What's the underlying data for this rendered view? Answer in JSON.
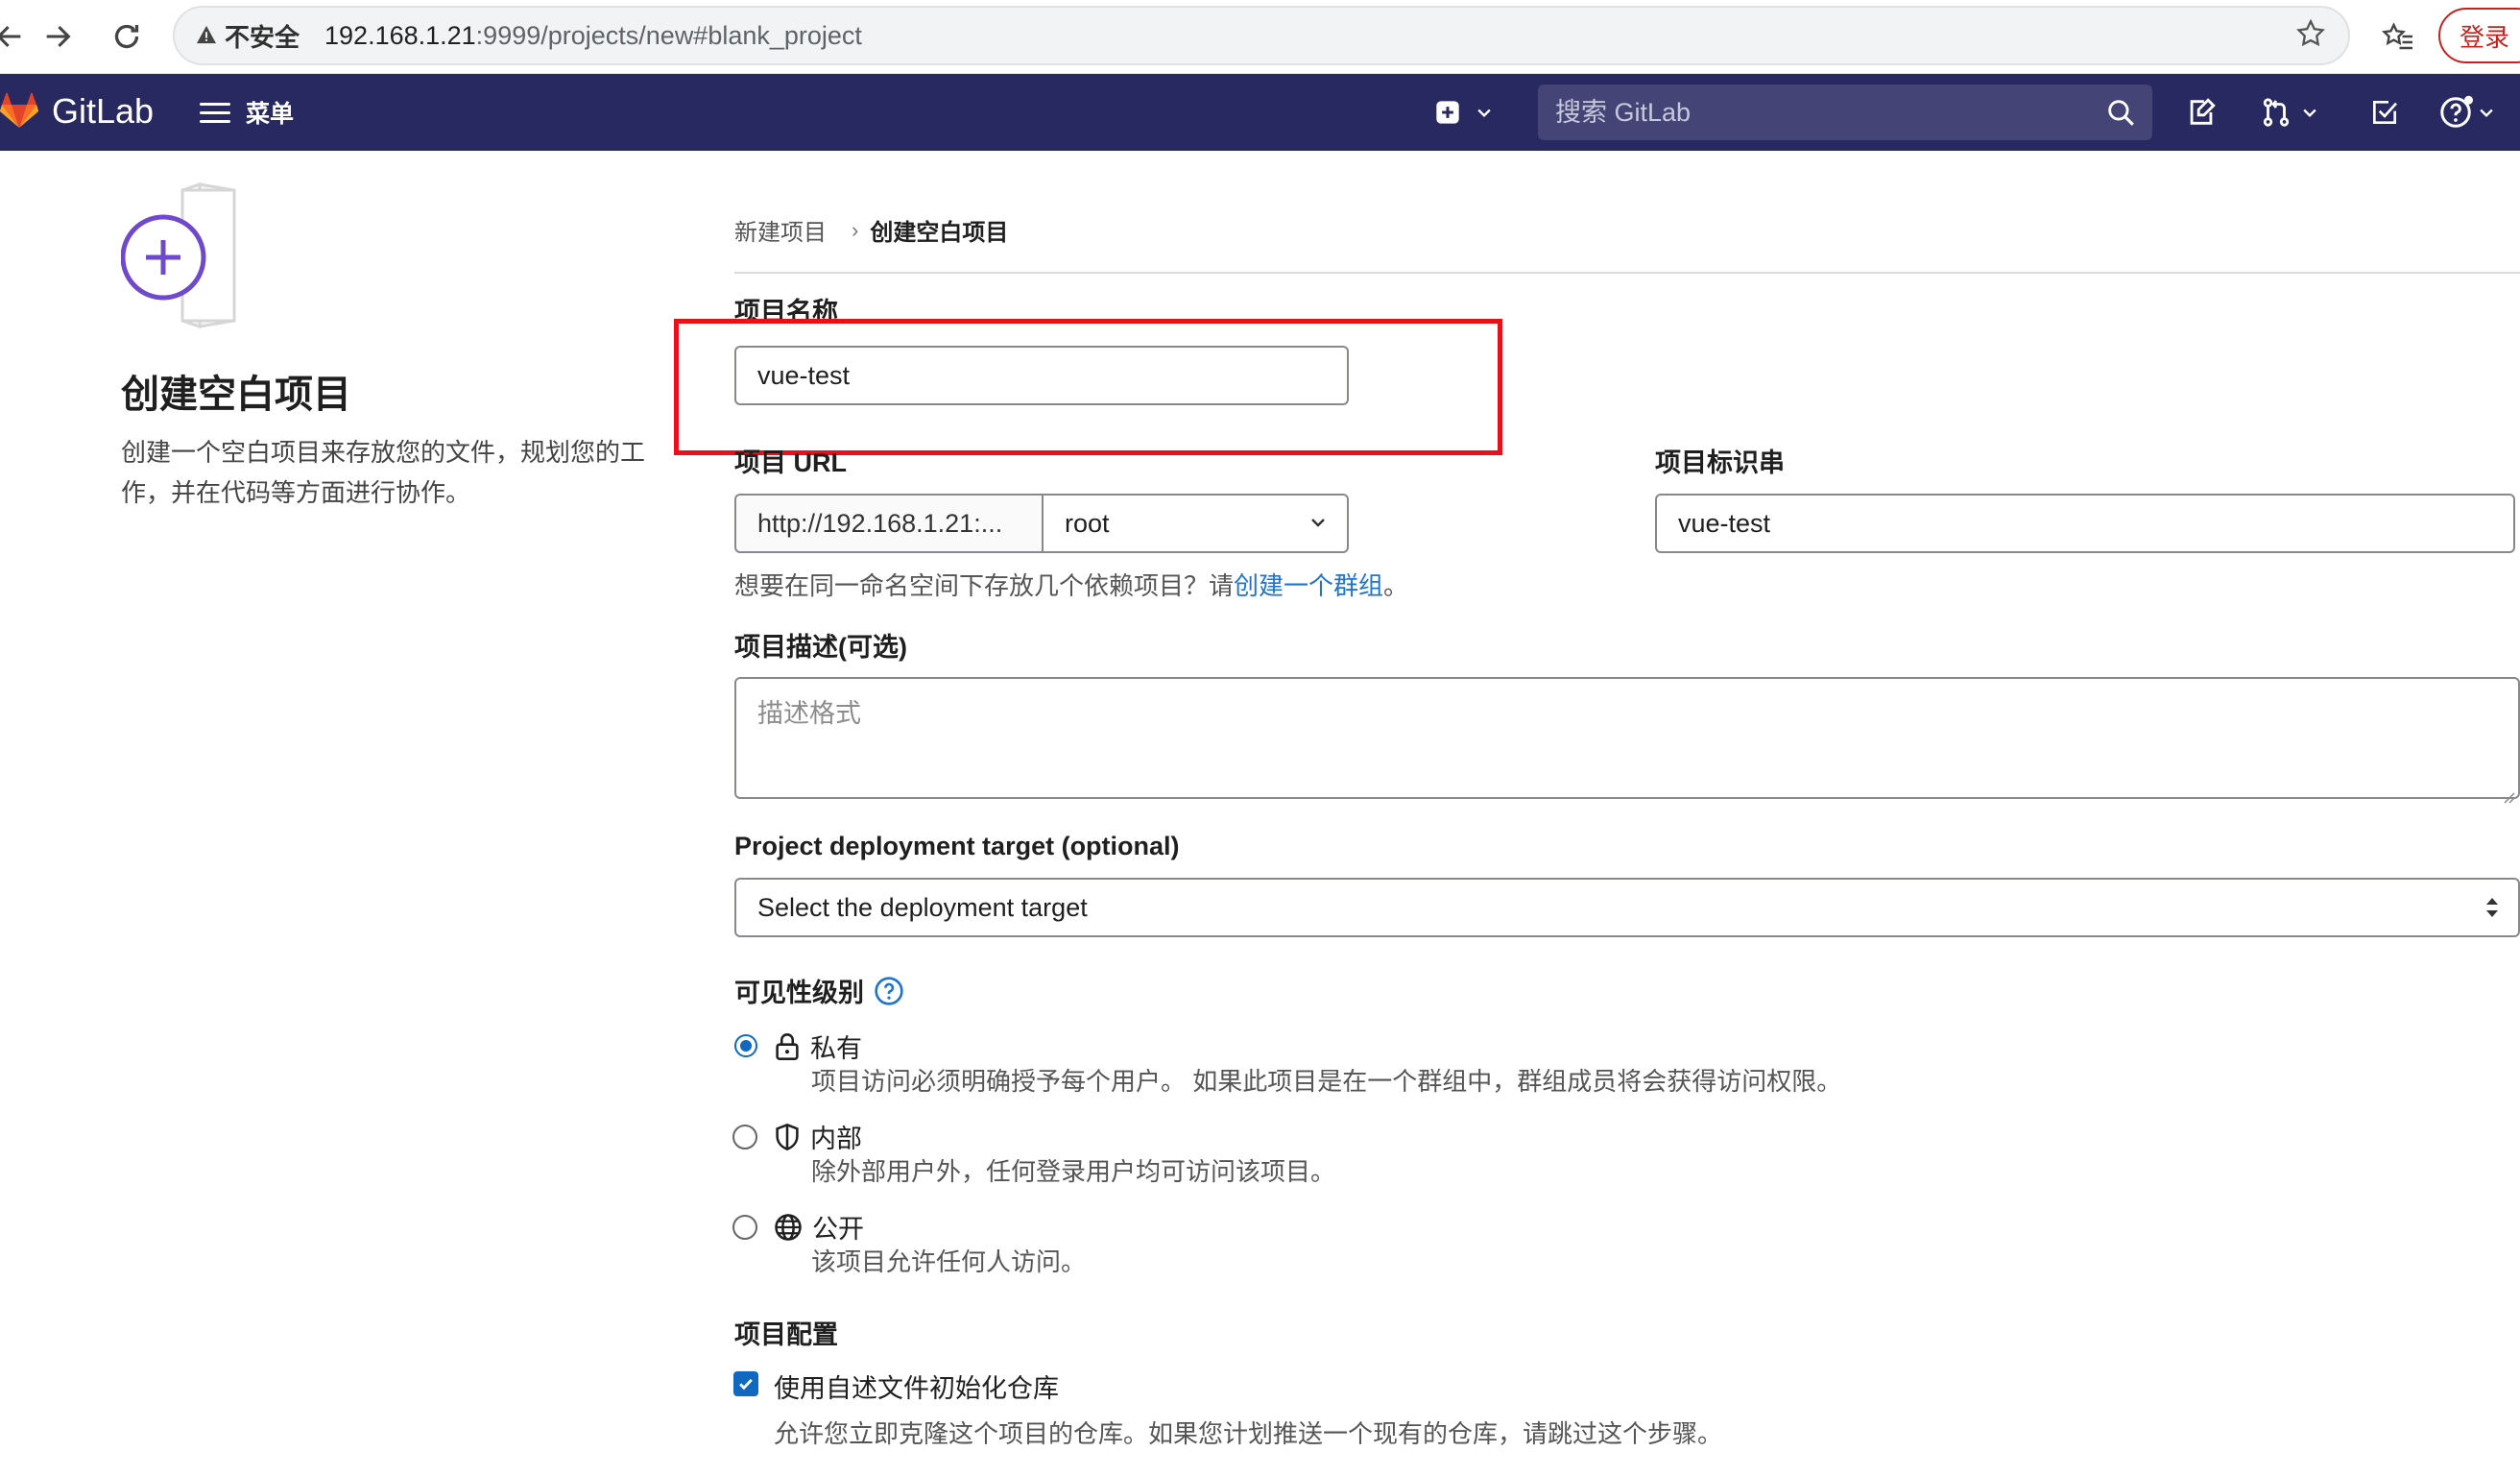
{
  "browser": {
    "security_label": "不安全",
    "url_host": "192.168.1.21",
    "url_rest": ":9999/projects/new#blank_project",
    "login_label": "登录"
  },
  "topbar": {
    "brand": "GitLab",
    "menu_label": "菜单",
    "search_placeholder": "搜索 GitLab"
  },
  "left": {
    "title": "创建空白项目",
    "description": "创建一个空白项目来存放您的文件，规划您的工作，并在代码等方面进行协作。"
  },
  "breadcrumb": {
    "parent": "新建项目",
    "current": "创建空白项目"
  },
  "form": {
    "project_name_label": "项目名称",
    "project_name_value": "vue-test",
    "project_url_label": "项目 URL",
    "project_url_prefix": "http://192.168.1.21:...",
    "namespace_value": "root",
    "slug_label": "项目标识串",
    "slug_value": "vue-test",
    "group_help_prefix": "想要在同一命名空间下存放几个依赖项目？请",
    "group_help_link": "创建一个群组",
    "group_help_suffix": "。",
    "description_label": "项目描述(可选)",
    "description_placeholder": "描述格式",
    "deploy_label": "Project deployment target (optional)",
    "deploy_value": "Select the deployment target",
    "visibility_label": "可见性级别",
    "visibility_options": [
      {
        "title": "私有",
        "desc": "项目访问必须明确授予每个用户。 如果此项目是在一个群组中，群组成员将会获得访问权限。",
        "selected": true
      },
      {
        "title": "内部",
        "desc": "除外部用户外，任何登录用户均可访问该项目。",
        "selected": false
      },
      {
        "title": "公开",
        "desc": "该项目允许任何人访问。",
        "selected": false
      }
    ],
    "config_label": "项目配置",
    "readme_label": "使用自述文件初始化仓库",
    "readme_desc": "允许您立即克隆这个项目的仓库。如果您计划推送一个现有的仓库，请跳过这个步骤。"
  },
  "colors": {
    "topbar_bg": "#292961",
    "accent_blue": "#1068bf",
    "link_blue": "#1f75cb",
    "highlight_red": "#e8101a",
    "gitlab_orange": "#fc6d26"
  }
}
